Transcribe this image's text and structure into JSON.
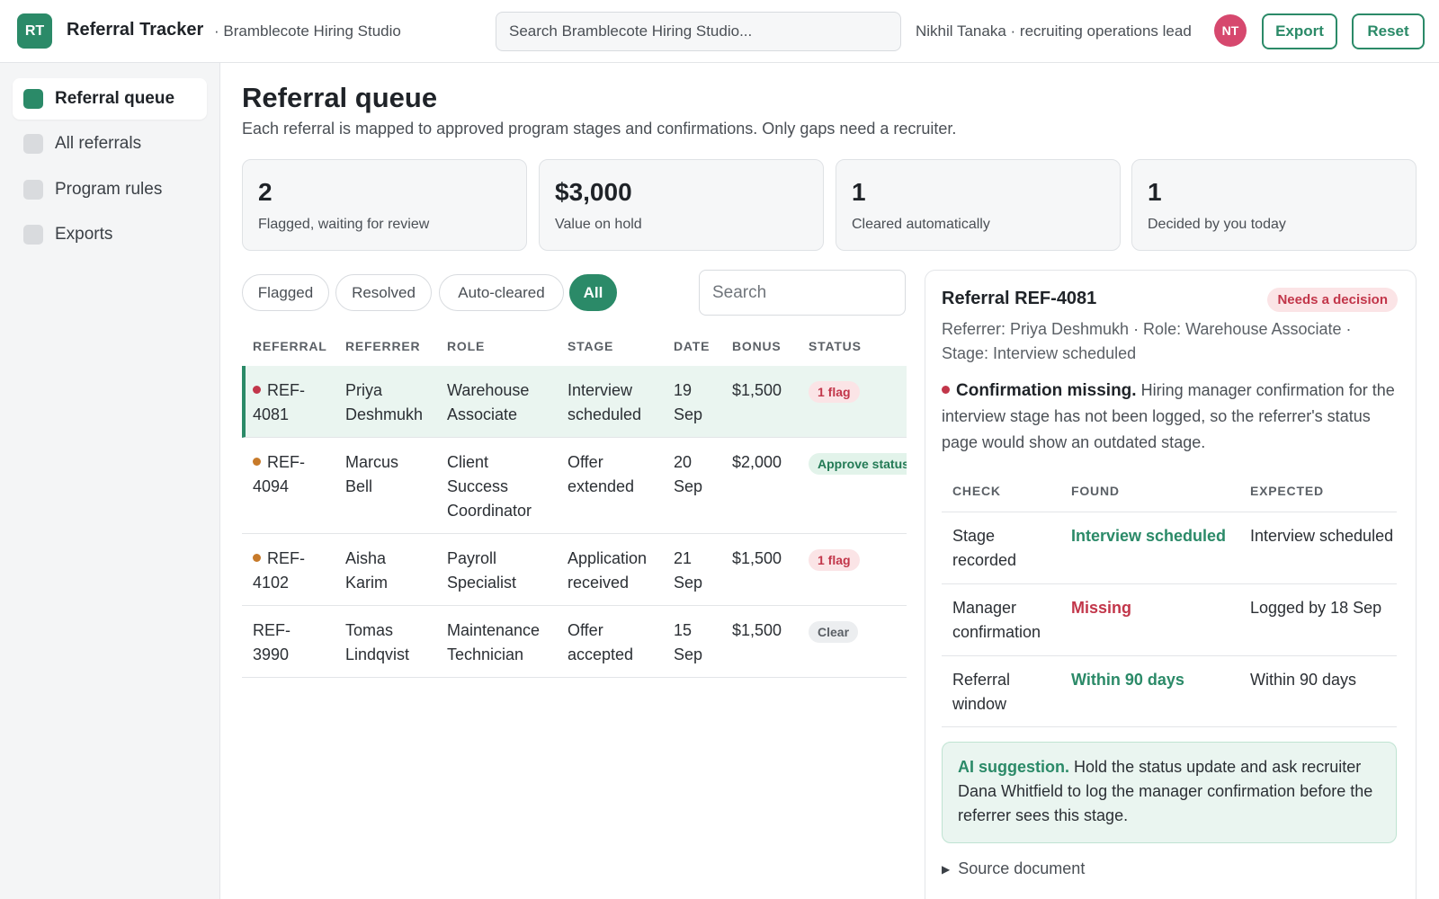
{
  "app": {
    "logo_initials": "RT",
    "title": "Referral Tracker",
    "org": "· Bramblecote Hiring Studio",
    "search_placeholder": "Search Bramblecote Hiring Studio...",
    "user_label": "Nikhil Tanaka · recruiting operations lead",
    "user_initials": "NT",
    "export_label": "Export",
    "reset_label": "Reset",
    "accent": "#2b8a68"
  },
  "sidebar": {
    "items": [
      {
        "label": "Referral queue",
        "active": true
      },
      {
        "label": "All referrals",
        "active": false
      },
      {
        "label": "Program rules",
        "active": false
      },
      {
        "label": "Exports",
        "active": false
      }
    ]
  },
  "main": {
    "title": "Referral queue",
    "subtitle": "Each referral is mapped to approved program stages and confirmations. Only gaps need a recruiter.",
    "stats": [
      {
        "value": "2",
        "label": "Flagged, waiting for review"
      },
      {
        "value": "$3,000",
        "label": "Value on hold"
      },
      {
        "value": "1",
        "label": "Cleared automatically"
      },
      {
        "value": "1",
        "label": "Decided by you today"
      }
    ],
    "filters": [
      "Flagged",
      "Resolved",
      "Auto-cleared",
      "All"
    ],
    "active_filter": "All",
    "search_placeholder": "Search"
  },
  "table": {
    "headers": [
      "REFERRAL",
      "REFERRER",
      "ROLE",
      "STAGE",
      "DATE",
      "BONUS",
      "STATUS"
    ],
    "rows": [
      {
        "ref_a": "REF-",
        "ref_b": "4081",
        "dot": "#c2364a",
        "referrer_a": "Priya",
        "referrer_b": "Deshmukh",
        "role_a": "Warehouse",
        "role_b": "Associate",
        "role_c": "",
        "stage_a": "Interview",
        "stage_b": "scheduled",
        "date_a": "19",
        "date_b": "Sep",
        "bonus": "$1,500",
        "status": "1 flag",
        "status_kind": "flag",
        "selected": true
      },
      {
        "ref_a": "REF-",
        "ref_b": "4094",
        "dot": "#c77a2a",
        "referrer_a": "Marcus",
        "referrer_b": "Bell",
        "role_a": "Client",
        "role_b": "Success",
        "role_c": "Coordinator",
        "stage_a": "Offer",
        "stage_b": "extended",
        "date_a": "20",
        "date_b": "Sep",
        "bonus": "$2,000",
        "status": "Approve status",
        "status_kind": "approve",
        "selected": false
      },
      {
        "ref_a": "REF-",
        "ref_b": "4102",
        "dot": "#c77a2a",
        "referrer_a": "Aisha",
        "referrer_b": "Karim",
        "role_a": "Payroll",
        "role_b": "Specialist",
        "role_c": "",
        "stage_a": "Application",
        "stage_b": "received",
        "date_a": "21",
        "date_b": "Sep",
        "bonus": "$1,500",
        "status": "1 flag",
        "status_kind": "flag",
        "selected": false
      },
      {
        "ref_a": "REF-",
        "ref_b": "3990",
        "dot": "",
        "referrer_a": "Tomas",
        "referrer_b": "Lindqvist",
        "role_a": "Maintenance",
        "role_b": "Technician",
        "role_c": "",
        "stage_a": "Offer",
        "stage_b": "accepted",
        "date_a": "15",
        "date_b": "Sep",
        "bonus": "$1,500",
        "status": "Clear",
        "status_kind": "clear",
        "selected": false
      }
    ]
  },
  "detail": {
    "title": "Referral REF-4081",
    "badge": "Needs a decision",
    "meta": "Referrer: Priya Deshmukh · Role: Warehouse Associate · Stage: Interview scheduled",
    "warning_title": "Confirmation missing.",
    "warning_body": "Hiring manager confirmation for the interview stage has not been logged, so the referrer's status page would show an outdated stage.",
    "check_headers": [
      "CHECK",
      "FOUND",
      "EXPECTED"
    ],
    "checks": [
      {
        "check_a": "Stage",
        "check_b": "recorded",
        "found": "Interview scheduled",
        "found_ok": true,
        "expected": "Interview scheduled"
      },
      {
        "check_a": "Manager",
        "check_b": "confirmation",
        "found": "Missing",
        "found_ok": false,
        "expected": "Logged by 18 Sep"
      },
      {
        "check_a": "Referral",
        "check_b": "window",
        "found": "Within 90 days",
        "found_ok": true,
        "expected": "Within 90 days"
      }
    ],
    "ai_label": "AI suggestion.",
    "ai_text": "Hold the status update and ask recruiter Dana Whitfield to log the manager confirmation before the referrer sees this stage.",
    "source_label": "Source document"
  }
}
